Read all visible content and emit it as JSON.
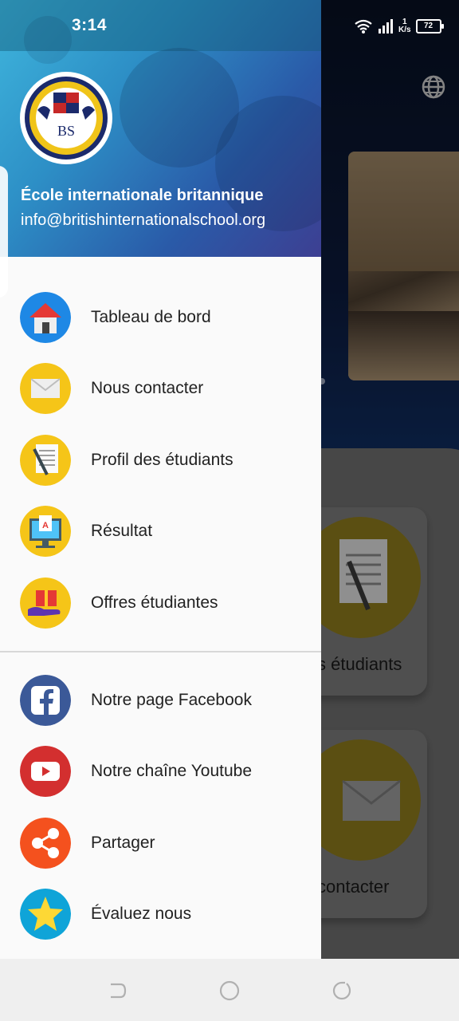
{
  "status": {
    "time": "3:14",
    "speed_top": "1",
    "speed_bottom": "K/s",
    "battery": "72"
  },
  "drawer": {
    "school_name": "École internationale britannique",
    "email": "info@britishinternationalschool.org",
    "logo_initials": "BS",
    "menu": [
      {
        "label": "Tableau de bord",
        "icon": "home-icon"
      },
      {
        "label": "Nous contacter",
        "icon": "envelope-icon"
      },
      {
        "label": "Profil des étudiants",
        "icon": "notepad-icon"
      },
      {
        "label": "Résultat",
        "icon": "result-screen-icon"
      },
      {
        "label": "Offres étudiantes",
        "icon": "gift-hand-icon"
      }
    ],
    "social": [
      {
        "label": "Notre page Facebook",
        "icon": "facebook-icon"
      },
      {
        "label": "Notre chaîne Youtube",
        "icon": "youtube-icon"
      },
      {
        "label": "Partager",
        "icon": "share-icon"
      },
      {
        "label": "Évaluez nous",
        "icon": "star-icon"
      }
    ]
  },
  "background": {
    "card_1_label": "s étudiants",
    "card_2_label": "contacter"
  },
  "colors": {
    "drawer_bg": "#fafafa",
    "header_gradient_start": "#3fb6dd",
    "header_gradient_end": "#3d3f92",
    "icon_yellow": "#f5c518",
    "icon_blue": "#1e88e5",
    "facebook_blue": "#3b5998",
    "youtube_red": "#d32f2f",
    "share_orange": "#f4511e",
    "star_teal": "#0fa4d8"
  }
}
